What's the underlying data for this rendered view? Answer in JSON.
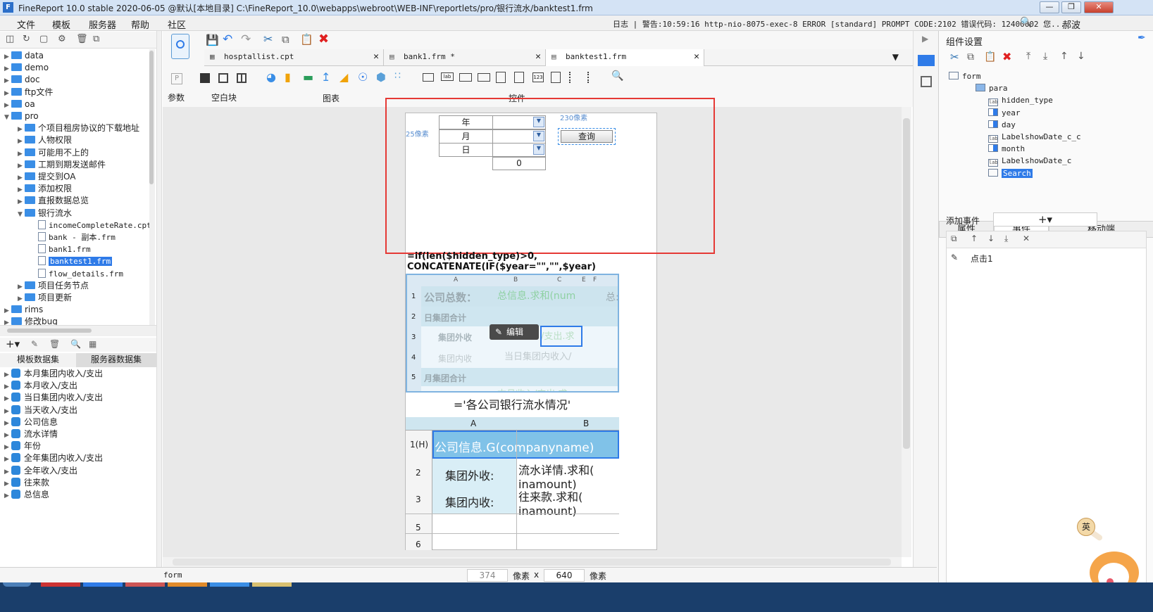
{
  "title": {
    "logo": "F",
    "text": "FineReport 10.0 stable 2020-06-05 @默认[本地目录]    C:\\FineReport_10.0\\webapps\\webroot\\WEB-INF\\reportlets/pro/银行流水/banktest1.frm",
    "min": "—",
    "max": "❐",
    "close": "✕"
  },
  "menu": {
    "items": [
      "文件",
      "模板",
      "服务器",
      "帮助",
      "社区"
    ],
    "log": "日志 | 警告:10:59:16 http-nio-8075-exec-8 ERROR [standard] PROMPT CODE:2102 错误代码: 12400002 您...",
    "user": "郝波"
  },
  "tree": {
    "items": [
      {
        "t": "data",
        "lvl": 0,
        "type": "folder"
      },
      {
        "t": "demo",
        "lvl": 0,
        "type": "folder"
      },
      {
        "t": "doc",
        "lvl": 0,
        "type": "folder"
      },
      {
        "t": "ftp文件",
        "lvl": 0,
        "type": "folder"
      },
      {
        "t": "oa",
        "lvl": 0,
        "type": "folder"
      },
      {
        "t": "pro",
        "lvl": 0,
        "type": "folder",
        "open": true
      },
      {
        "t": "个项目租房协议的下载地址",
        "lvl": 1,
        "type": "folder"
      },
      {
        "t": "人物权限",
        "lvl": 1,
        "type": "folder"
      },
      {
        "t": "可能用不上的",
        "lvl": 1,
        "type": "folder"
      },
      {
        "t": "工期到期发送邮件",
        "lvl": 1,
        "type": "folder"
      },
      {
        "t": "提交到OA",
        "lvl": 1,
        "type": "folder"
      },
      {
        "t": "添加权限",
        "lvl": 1,
        "type": "folder"
      },
      {
        "t": "直报数据总览",
        "lvl": 1,
        "type": "folder"
      },
      {
        "t": "银行流水",
        "lvl": 1,
        "type": "folder",
        "open": true
      },
      {
        "t": "incomeCompleteRate.cpt",
        "lvl": 2,
        "type": "file"
      },
      {
        "t": "bank - 副本.frm",
        "lvl": 2,
        "type": "file"
      },
      {
        "t": "bank1.frm",
        "lvl": 2,
        "type": "file"
      },
      {
        "t": "banktest1.frm",
        "lvl": 2,
        "type": "file",
        "sel": true
      },
      {
        "t": "flow_details.frm",
        "lvl": 2,
        "type": "file"
      },
      {
        "t": "项目任务节点",
        "lvl": 1,
        "type": "folder"
      },
      {
        "t": "项目更新",
        "lvl": 1,
        "type": "folder"
      },
      {
        "t": "rims",
        "lvl": 0,
        "type": "folder"
      },
      {
        "t": "修改bug",
        "lvl": 0,
        "type": "folder"
      }
    ]
  },
  "datasets": {
    "tab1": "模板数据集",
    "tab2": "服务器数据集",
    "items": [
      "本月集团内收入/支出",
      "本月收入/支出",
      "当日集团内收入/支出",
      "当天收入/支出",
      "公司信息",
      "流水详情",
      "年份",
      "全年集团内收入/支出",
      "全年收入/支出",
      "往来款",
      "总信息"
    ]
  },
  "tabs": [
    {
      "label": "hosptallist.cpt"
    },
    {
      "label": "bank1.frm *"
    },
    {
      "label": "banktest1.frm"
    }
  ],
  "toolgroups": {
    "param": "参数",
    "blank": "空白块",
    "chart": "图表",
    "control": "控件"
  },
  "form": {
    "rows": [
      "年",
      "月",
      "日"
    ],
    "zero": "0",
    "query": "查询",
    "px25": "25像素",
    "px230": "230像素"
  },
  "report1": {
    "formula": "=if(len($hidden_type)>0, CONCATENATE(IF($year=\"\",\"\",$year)",
    "cols": [
      "A",
      "B",
      "C",
      "E",
      "F"
    ],
    "rows": [
      "1",
      "2",
      "3",
      "4",
      "5"
    ],
    "c1a": "公司总数：",
    "c1b": "总信息.求和(num",
    "c1c": "总:",
    "c2": "日集团合计",
    "c3a": "集团外收",
    "c3b": "/支出.求",
    "c4a": "集团内收",
    "c4b": "当日集团内收入/",
    "c5": "月集团合计",
    "c6": "本月收入/支出.求",
    "edit": "编辑"
  },
  "report2": {
    "title": "='各公司银行流水情况'",
    "cols": [
      "A",
      "B"
    ],
    "rows": [
      "1(H)",
      "2",
      "3",
      "5",
      "6"
    ],
    "r1": "公司信息.G(companyname)",
    "r2a": "集团外收:",
    "r2b": "流水详情.求和(",
    "r2c": "inamount)",
    "r3a": "集团内收:",
    "r3b": "往来款.求和(",
    "r3c": "inamount)"
  },
  "right": {
    "title": "组件设置",
    "tree": [
      "form",
      "para",
      "hidden_type",
      "year",
      "day",
      "LabelshowDate_c_c",
      "month",
      "LabelshowDate_c",
      "Search"
    ],
    "tabs": [
      "属性",
      "事件",
      "移动端"
    ],
    "addEvent": "添加事件",
    "plus": "+▾",
    "event": "点击1"
  },
  "status": {
    "left": "form",
    "w": "374",
    "unit": "像素",
    "x": "x",
    "h": "640",
    "unit2": "像素"
  },
  "ime": "英"
}
